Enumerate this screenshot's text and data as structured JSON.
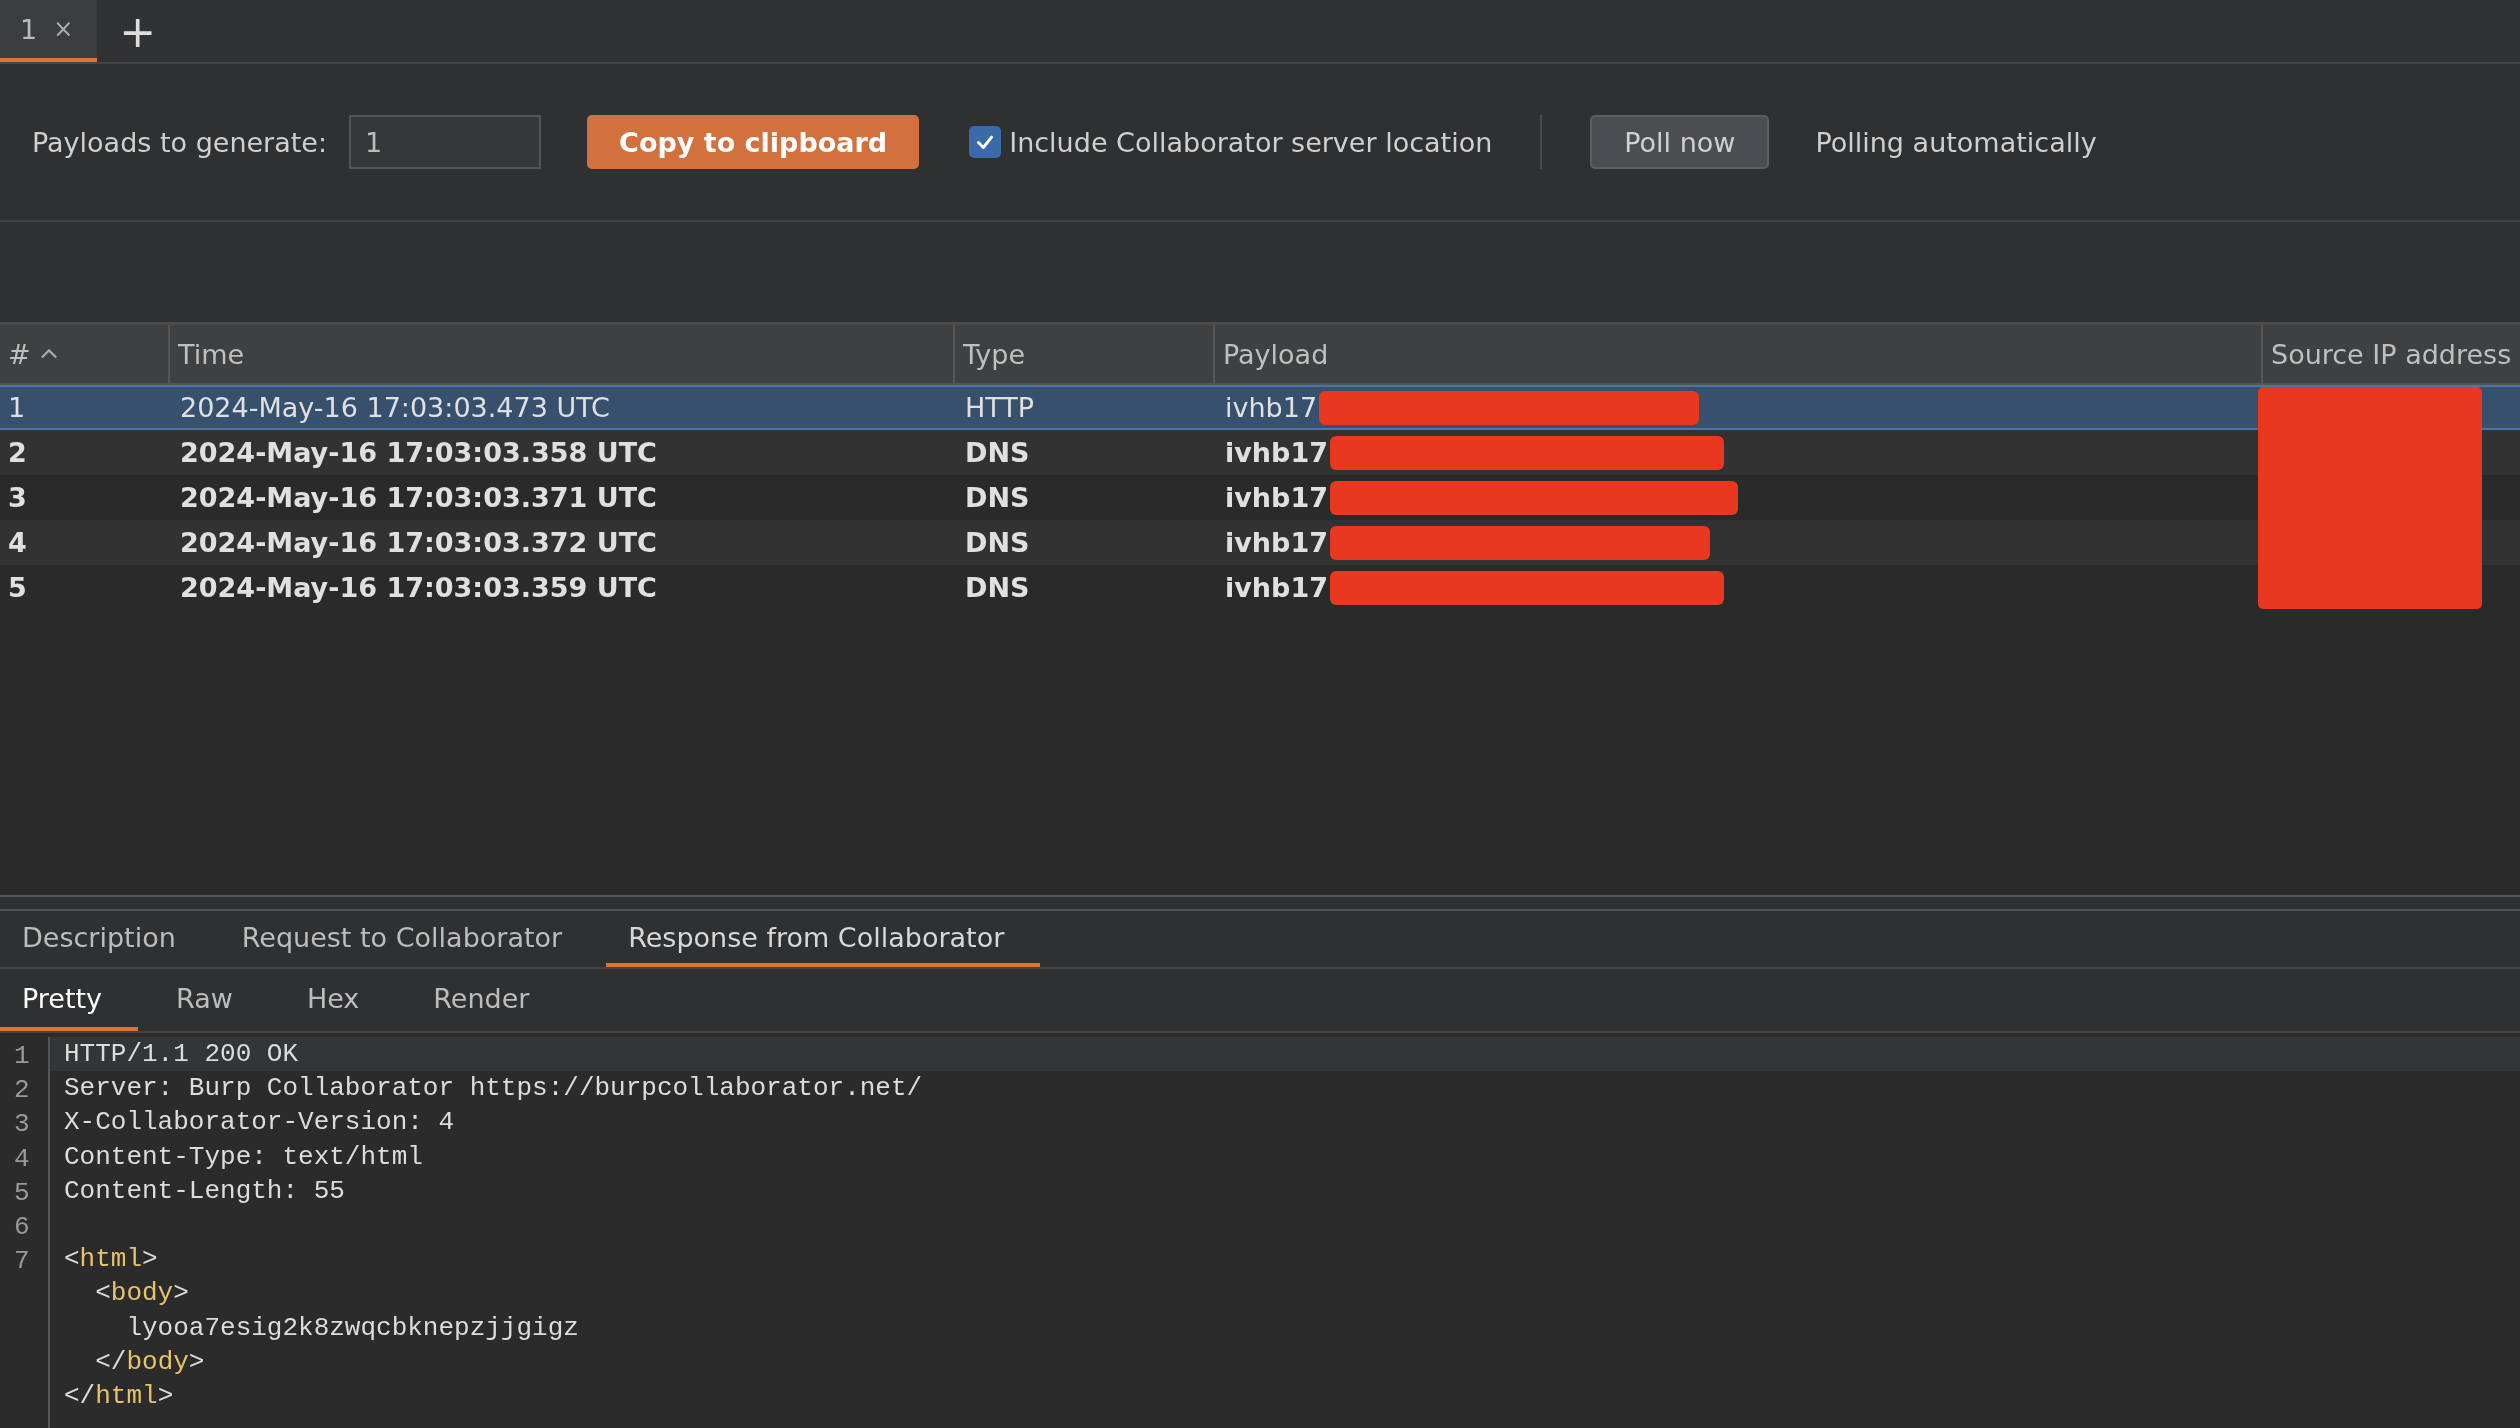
{
  "tabs": [
    {
      "label": "1",
      "close": "×",
      "selected": true
    }
  ],
  "new_tab": "+",
  "toolbar": {
    "payloads_label": "Payloads to generate:",
    "payloads_value": "1",
    "copy_button": "Copy to clipboard",
    "include_location": {
      "label": "Include Collaborator server location",
      "checked": true
    },
    "poll_button": "Poll now",
    "polling_status": "Polling automatically"
  },
  "table": {
    "columns": [
      {
        "label": "#",
        "sorted": true
      },
      {
        "label": "Time",
        "sorted": false
      },
      {
        "label": "Type",
        "sorted": false
      },
      {
        "label": "Payload",
        "sorted": false
      },
      {
        "label": "Source IP address",
        "sorted": false
      }
    ],
    "rows": [
      {
        "number": "1",
        "time": "2024-May-16 17:03:03.473 UTC",
        "type": "HTTP",
        "payload": "ivhb17",
        "selected": true,
        "unread": false
      },
      {
        "number": "2",
        "time": "2024-May-16 17:03:03.358 UTC",
        "type": "DNS",
        "payload": "ivhb17",
        "selected": false,
        "unread": true
      },
      {
        "number": "3",
        "time": "2024-May-16 17:03:03.371 UTC",
        "type": "DNS",
        "payload": "ivhb17",
        "selected": false,
        "unread": true
      },
      {
        "number": "4",
        "time": "2024-May-16 17:03:03.372 UTC",
        "type": "DNS",
        "payload": "ivhb17",
        "selected": false,
        "unread": true
      },
      {
        "number": "5",
        "time": "2024-May-16 17:03:03.359 UTC",
        "type": "DNS",
        "payload": "ivhb17",
        "selected": false,
        "unread": true
      }
    ]
  },
  "detail_tabs": [
    {
      "label": "Description",
      "selected": false
    },
    {
      "label": "Request to Collaborator",
      "selected": false
    },
    {
      "label": "Response from Collaborator",
      "selected": true
    }
  ],
  "view_tabs": [
    {
      "label": "Pretty",
      "selected": true
    },
    {
      "label": "Raw",
      "selected": false
    },
    {
      "label": "Hex",
      "selected": false
    },
    {
      "label": "Render",
      "selected": false
    }
  ],
  "code_lines": [
    {
      "number": "1",
      "segments": [
        {
          "kind": "text",
          "text": "HTTP/1.1 200 OK"
        }
      ]
    },
    {
      "number": "2",
      "segments": [
        {
          "kind": "text",
          "text": "Server: Burp Collaborator https://burpcollaborator.net/"
        }
      ]
    },
    {
      "number": "3",
      "segments": [
        {
          "kind": "text",
          "text": "X-Collaborator-Version: 4"
        }
      ]
    },
    {
      "number": "4",
      "segments": [
        {
          "kind": "text",
          "text": "Content-Type: text/html"
        }
      ]
    },
    {
      "number": "5",
      "segments": [
        {
          "kind": "text",
          "text": "Content-Length: 55"
        }
      ]
    },
    {
      "number": "6"
    },
    {
      "number": "7",
      "segments": [
        {
          "kind": "text",
          "text": "<"
        },
        {
          "kind": "tag",
          "text": "html"
        },
        {
          "kind": "text",
          "text": ">"
        }
      ]
    },
    {
      "segments": [
        {
          "kind": "text",
          "text": "  <"
        },
        {
          "kind": "tag",
          "text": "body"
        },
        {
          "kind": "text",
          "text": ">"
        }
      ]
    },
    {
      "segments": [
        {
          "kind": "text",
          "text": "    lyooa7esig2k8zwqcbknepzjjgigz"
        }
      ]
    },
    {
      "segments": [
        {
          "kind": "text",
          "text": "  </"
        },
        {
          "kind": "tag",
          "text": "body"
        },
        {
          "kind": "text",
          "text": ">"
        }
      ]
    },
    {
      "segments": [
        {
          "kind": "text",
          "text": "</"
        },
        {
          "kind": "tag",
          "text": "html"
        },
        {
          "kind": "text",
          "text": ">"
        }
      ]
    }
  ]
}
